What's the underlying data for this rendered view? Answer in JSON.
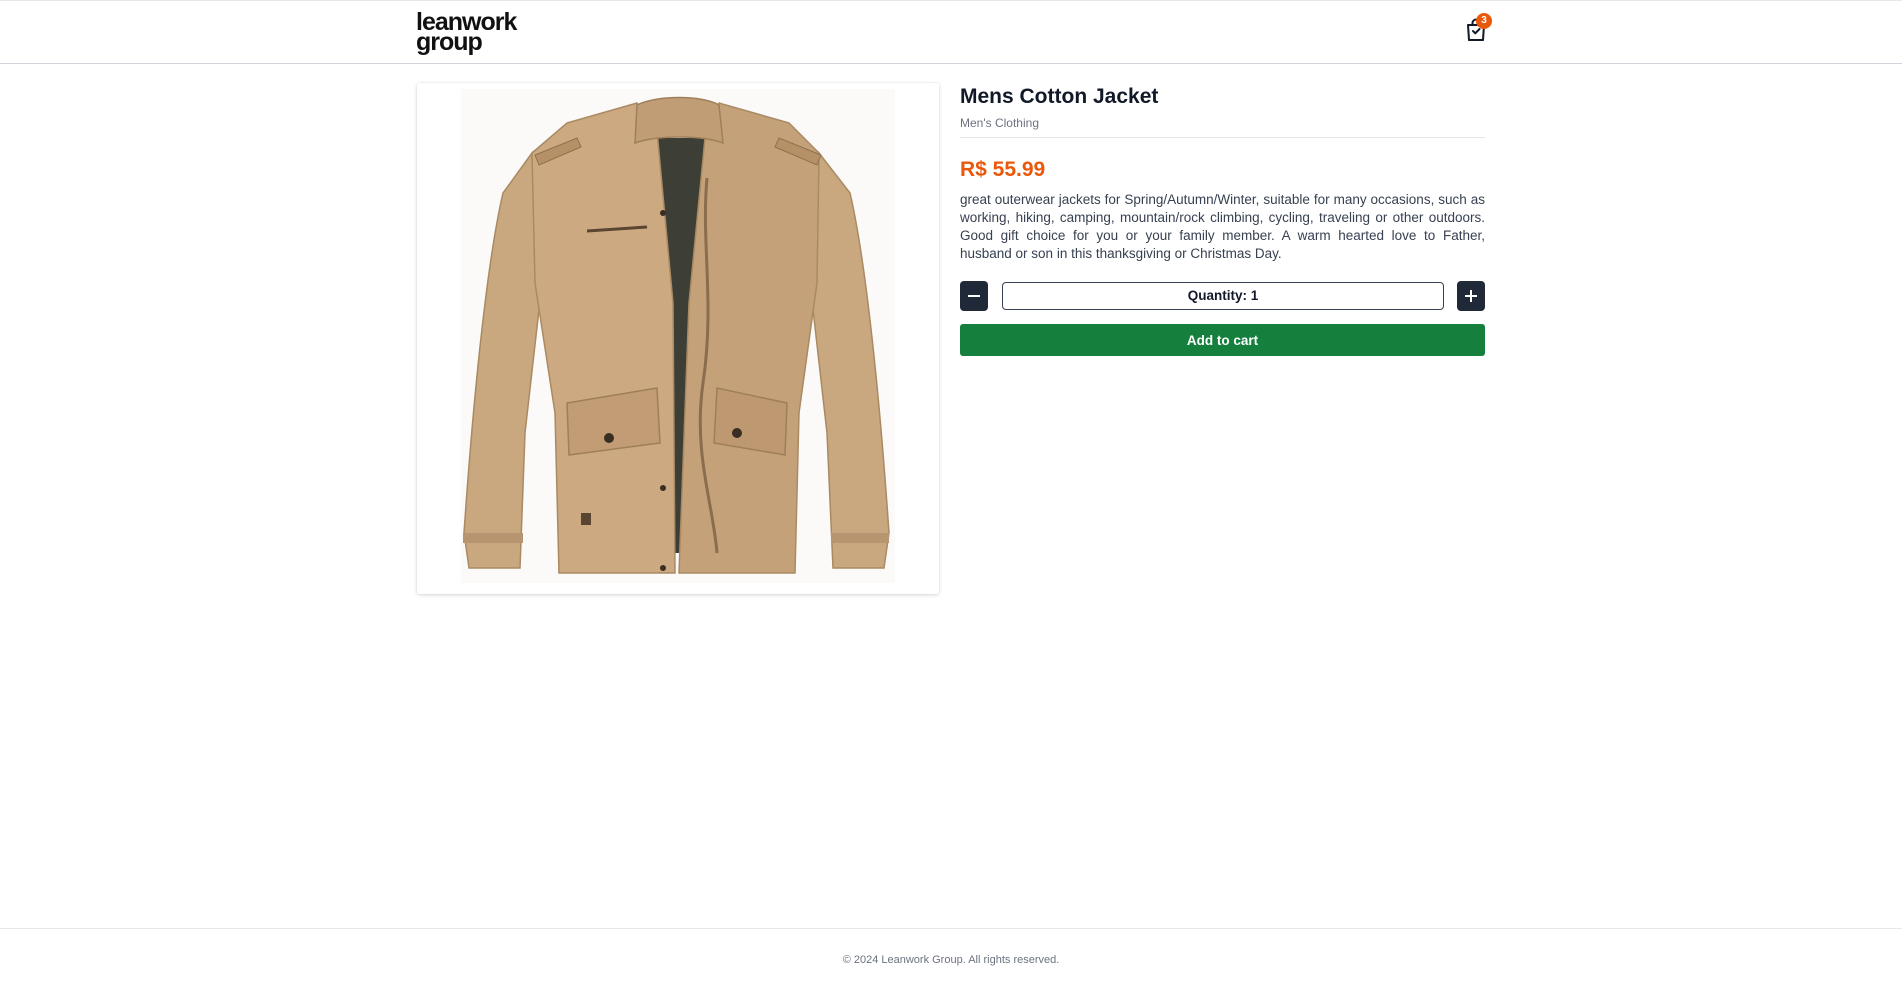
{
  "header": {
    "logo_line1": "leanwork",
    "logo_line2": "group",
    "cart_count": "3"
  },
  "product": {
    "image_alt": "Mens Cotton Jacket",
    "title": "Mens Cotton Jacket",
    "category": "Men's Clothing",
    "price": "R$ 55.99",
    "description": "great outerwear jackets for Spring/Autumn/Winter, suitable for many occasions, such as working, hiking, camping, mountain/rock climbing, cycling, traveling or other outdoors. Good gift choice for you or your family member. A warm hearted love to Father, husband or son in this thanksgiving or Christmas Day.",
    "quantity_label": "Quantity: 1",
    "add_to_cart_label": "Add to cart"
  },
  "footer": {
    "copyright": "© 2024 Leanwork Group. All rights reserved."
  },
  "colors": {
    "price": "#ea580c",
    "add_to_cart": "#15803d",
    "qty_button": "#1f2937",
    "badge": "#ea580c",
    "jacket": "#c9a77f"
  },
  "icons": {
    "cart": "shopping-bag-icon",
    "decrease": "minus-icon",
    "increase": "plus-icon"
  }
}
